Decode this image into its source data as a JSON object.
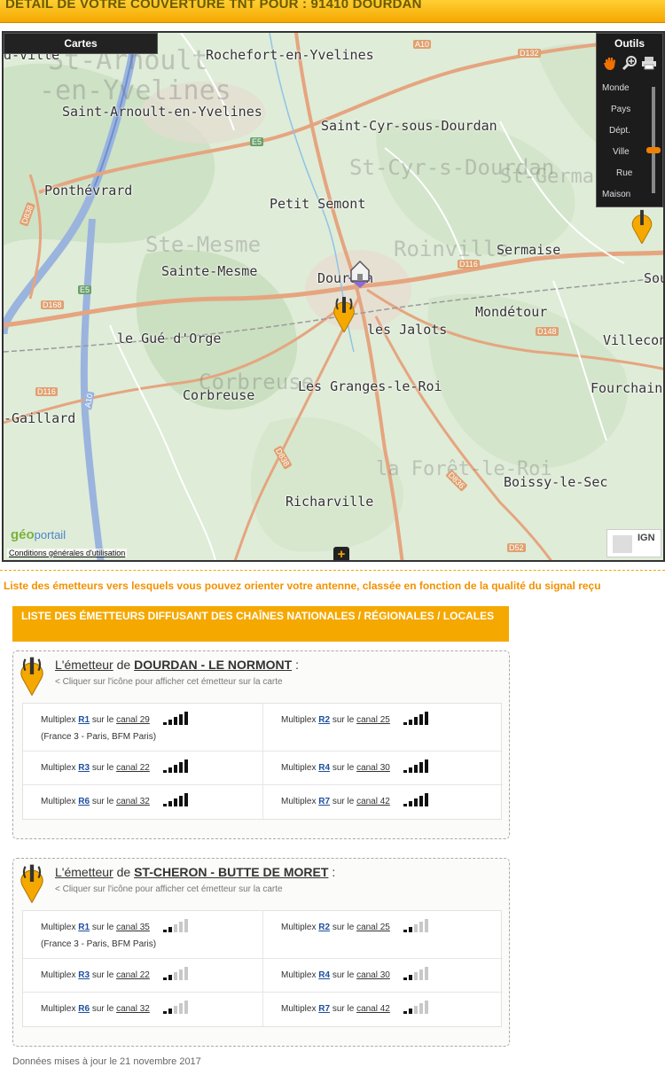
{
  "header": {
    "title": "DETAIL DE VOTRE COUVERTURE TNT POUR : 91410 DOURDAN"
  },
  "map": {
    "cartes_label": "Cartes",
    "tools": {
      "title": "Outils",
      "zoom_levels": [
        "Monde",
        "Pays",
        "Dépt.",
        "Ville",
        "Rue",
        "Maison"
      ],
      "selected_zoom": "Ville"
    },
    "places": [
      {
        "name": "Rochefort-en-Yvelines",
        "key": "rochefort"
      },
      {
        "name": "Saint-Arnoult-en-Yvelines",
        "key": "saint-arnoult"
      },
      {
        "name": "Saint-Cyr-sous-Dourdan",
        "key": "saint-cyr"
      },
      {
        "name": "Ponthévrard",
        "key": "ponthevrard"
      },
      {
        "name": "Petit Semont",
        "key": "petit-semont"
      },
      {
        "name": "Sainte-Mesme",
        "key": "sainte-mesme"
      },
      {
        "name": "Sermaise",
        "key": "sermaise"
      },
      {
        "name": "Dourdan",
        "key": "dourdan"
      },
      {
        "name": "Mondétour",
        "key": "mondetour"
      },
      {
        "name": "les Jalots",
        "key": "les-jalots"
      },
      {
        "name": "le Gué d'Orge",
        "key": "gue-dorge"
      },
      {
        "name": "Villeconi",
        "key": "villeconi"
      },
      {
        "name": "Les Granges-le-Roi",
        "key": "granges"
      },
      {
        "name": "Fourchainv",
        "key": "fourchainv"
      },
      {
        "name": "Corbreuse",
        "key": "corbreuse"
      },
      {
        "name": "-Gaillard",
        "key": "gaillard"
      },
      {
        "name": "Boissy-le-Sec",
        "key": "boissy"
      },
      {
        "name": "Richarville",
        "key": "richarville"
      },
      {
        "name": "Sou",
        "key": "sou"
      },
      {
        "name": "d-ville",
        "key": "d-ville"
      }
    ],
    "roads": [
      "A10",
      "E5",
      "D838",
      "D116",
      "D168",
      "E5",
      "D116",
      "D148",
      "D836",
      "D838",
      "A10",
      "D52",
      "D132"
    ],
    "geoportail": {
      "geo": "géo",
      "portail": "portail"
    },
    "conditions_link": "Conditions générales d'utilisation",
    "ign_label": "IGN",
    "expand_icon": "+"
  },
  "intro_text": "Liste des émetteurs vers lesquels vous pouvez orienter votre antenne, classée en fonction de la qualité du signal reçu",
  "section_title": "LISTE DES ÉMETTEURS DIFFUSANT DES CHAÎNES NATIONALES / RÉGIONALES / LOCALES",
  "transmitters": [
    {
      "prefix": "L'émetteur",
      "de": "de",
      "name": "DOURDAN - LE NORMONT",
      "suffix": ":",
      "hint": "< Cliquer sur l'icône pour afficher cet émetteur sur la carte",
      "multiplexes": [
        {
          "label": "Multiplex",
          "mux": "R1",
          "sur": "sur le",
          "canal": "canal 29",
          "signal": 5,
          "note": "(France 3 - Paris, BFM Paris)"
        },
        {
          "label": "Multiplex",
          "mux": "R2",
          "sur": "sur le",
          "canal": "canal 25",
          "signal": 5
        },
        {
          "label": "Multiplex",
          "mux": "R3",
          "sur": "sur le",
          "canal": "canal 22",
          "signal": 5
        },
        {
          "label": "Multiplex",
          "mux": "R4",
          "sur": "sur le",
          "canal": "canal 30",
          "signal": 5
        },
        {
          "label": "Multiplex",
          "mux": "R6",
          "sur": "sur le",
          "canal": "canal 32",
          "signal": 5
        },
        {
          "label": "Multiplex",
          "mux": "R7",
          "sur": "sur le",
          "canal": "canal 42",
          "signal": 5
        }
      ]
    },
    {
      "prefix": "L'émetteur",
      "de": "de",
      "name": "ST-CHERON - BUTTE DE MORET",
      "suffix": ":",
      "hint": "< Cliquer sur l'icône pour afficher cet émetteur sur la carte",
      "multiplexes": [
        {
          "label": "Multiplex",
          "mux": "R1",
          "sur": "sur le",
          "canal": "canal 35",
          "signal": 2,
          "note": "(France 3 - Paris, BFM Paris)"
        },
        {
          "label": "Multiplex",
          "mux": "R2",
          "sur": "sur le",
          "canal": "canal 25",
          "signal": 2
        },
        {
          "label": "Multiplex",
          "mux": "R3",
          "sur": "sur le",
          "canal": "canal 22",
          "signal": 2
        },
        {
          "label": "Multiplex",
          "mux": "R4",
          "sur": "sur le",
          "canal": "canal 30",
          "signal": 2
        },
        {
          "label": "Multiplex",
          "mux": "R6",
          "sur": "sur le",
          "canal": "canal 32",
          "signal": 2
        },
        {
          "label": "Multiplex",
          "mux": "R7",
          "sur": "sur le",
          "canal": "canal 42",
          "signal": 2
        }
      ]
    }
  ],
  "footer_note": "Données mises à jour le 21 novembre 2017",
  "colors": {
    "accent": "#f5a800",
    "signal_on": "#111111",
    "signal_off": "#c8c8c8",
    "link": "#1d4fa0"
  }
}
